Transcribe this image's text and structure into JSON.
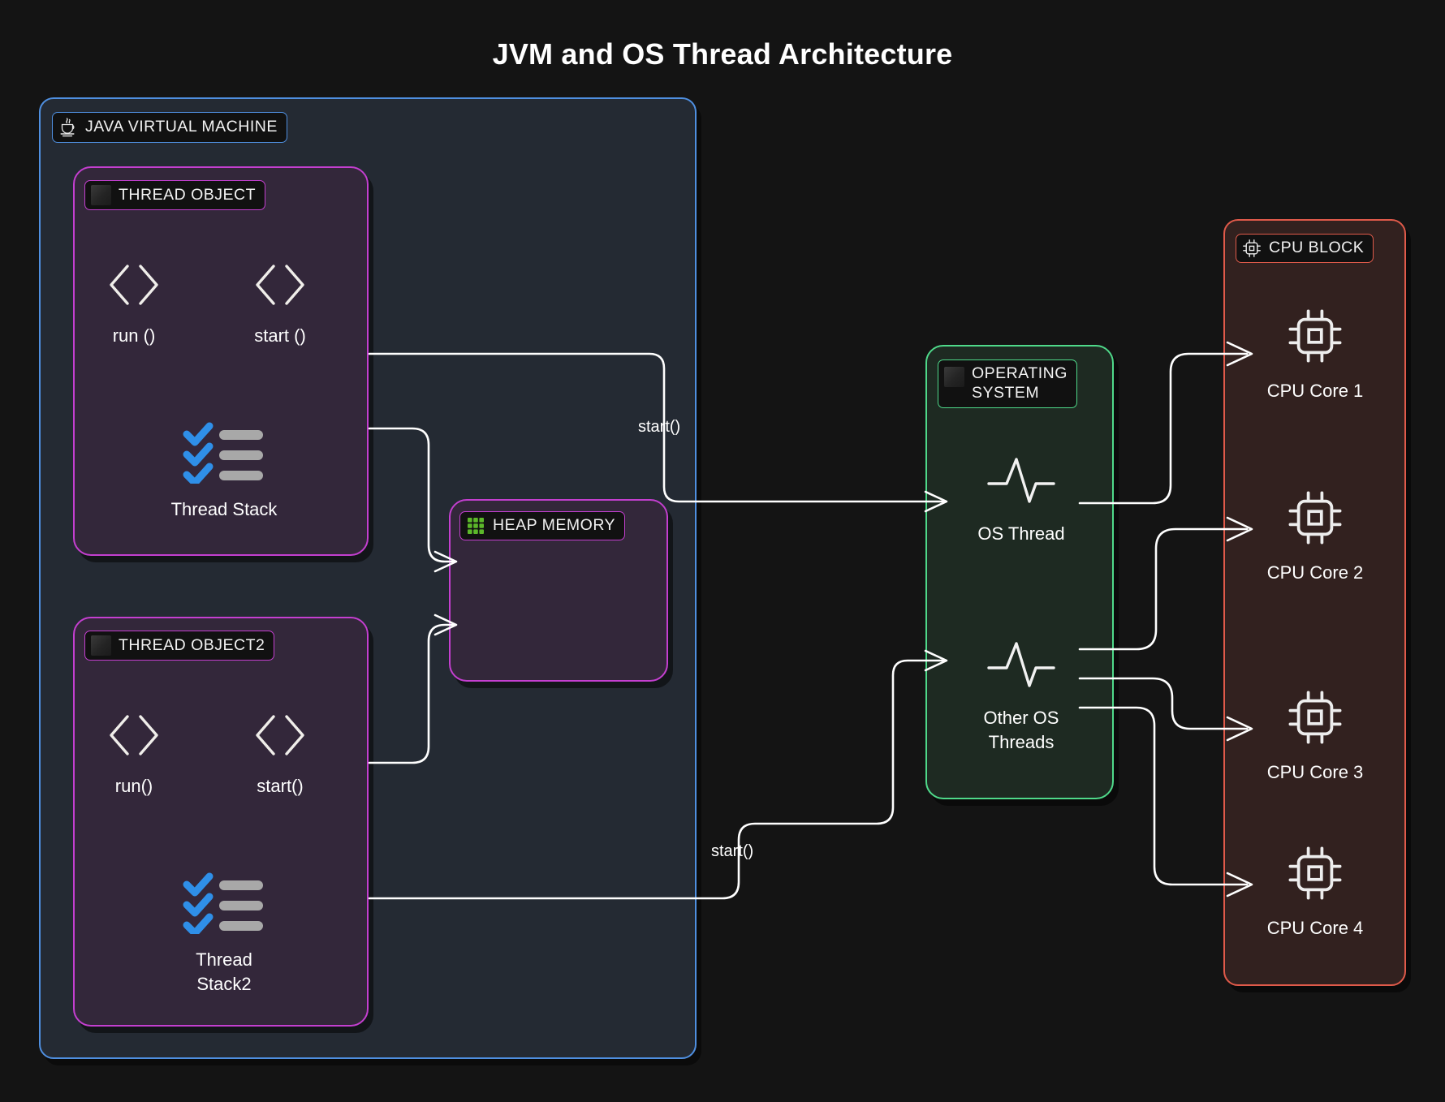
{
  "title": "JVM and OS Thread Architecture",
  "jvm": {
    "label": "JAVA VIRTUAL MACHINE",
    "icon": "java-cup-icon",
    "border_color": "#4f8fe0",
    "thread_object_1": {
      "label": "THREAD OBJECT",
      "icon": "dark-square-icon",
      "border_color": "#c43fd0",
      "methods": [
        {
          "icon": "code-brackets-icon",
          "label": "run ()"
        },
        {
          "icon": "code-brackets-icon",
          "label": "start ()"
        }
      ],
      "stack": {
        "icon": "checklist-icon",
        "label": "Thread Stack"
      }
    },
    "thread_object_2": {
      "label": "THREAD OBJECT2",
      "icon": "dark-square-icon",
      "border_color": "#c43fd0",
      "methods": [
        {
          "icon": "code-brackets-icon",
          "label": "run()"
        },
        {
          "icon": "code-brackets-icon",
          "label": "start()"
        }
      ],
      "stack": {
        "icon": "checklist-icon",
        "label": "Thread\nStack2"
      }
    },
    "heap": {
      "label": "HEAP MEMORY",
      "icon": "green-grid-icon",
      "border_color": "#c43fd0"
    }
  },
  "operating_system": {
    "label": "OPERATING\nSYSTEM",
    "icon": "dark-square-icon",
    "border_color": "#4fd98a",
    "threads": [
      {
        "icon": "pulse-wave-icon",
        "label": "OS Thread"
      },
      {
        "icon": "pulse-wave-icon",
        "label": "Other OS\nThreads"
      }
    ]
  },
  "cpu_block": {
    "label": "CPU BLOCK",
    "icon": "cpu-chip-icon",
    "border_color": "#e05a4a",
    "cores": [
      {
        "icon": "cpu-chip-icon",
        "label": "CPU Core 1"
      },
      {
        "icon": "cpu-chip-icon",
        "label": "CPU Core 2"
      },
      {
        "icon": "cpu-chip-icon",
        "label": "CPU Core 3"
      },
      {
        "icon": "cpu-chip-icon",
        "label": "CPU Core 4"
      }
    ]
  },
  "edges": {
    "start_label_1": "start()",
    "start_label_2": "start()"
  },
  "colors": {
    "background": "#141414",
    "jvm": "#4f8fe0",
    "thread": "#c43fd0",
    "os": "#4fd98a",
    "cpu": "#e05a4a",
    "wire": "#ffffff",
    "check_blue": "#2f8fe8",
    "grid_green": "#5cb82a"
  }
}
